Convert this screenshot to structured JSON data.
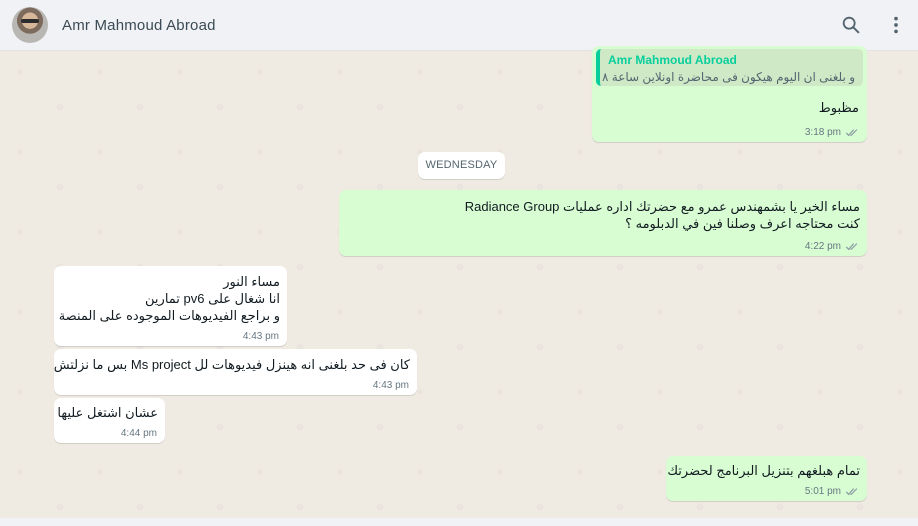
{
  "header": {
    "contact_name": "Amr Mahmoud Abroad",
    "search_icon": "search-icon",
    "menu_icon": "more-vertical-icon"
  },
  "colors": {
    "outgoing_bubble": "#d9fdd3",
    "incoming_bubble": "#ffffff",
    "chat_background": "#efeae2",
    "header_background": "#f0f2f5",
    "quote_accent": "#06cf9c",
    "tick_color": "#8696a0"
  },
  "date_separator": "WEDNESDAY",
  "messages": [
    {
      "direction": "out",
      "quote": {
        "author": "Amr Mahmoud Abroad",
        "text": "و بلغنى ان اليوم هيكون فى محاضرة اونلاين ساعة ٨"
      },
      "lines": [
        "مظبوط"
      ],
      "time": "3:18 pm",
      "status": "read"
    },
    {
      "direction": "out",
      "lines": [
        "مساء الخير يا بشمهندس عمرو مع حضرتك اداره عمليات Radiance Group",
        "كنت محتاجه اعرف وصلنا فين في الدبلومه ؟"
      ],
      "time": "4:22 pm",
      "status": "read"
    },
    {
      "direction": "in",
      "lines": [
        "مساء النور",
        "انا شغال على pv6 تمارين",
        "و براجع الفيديوهات الموجوده على المنصة"
      ],
      "time": "4:43 pm"
    },
    {
      "direction": "in",
      "lines": [
        "كان فى حد بلغنى انه هينزل فيديوهات لل Ms project بس ما نزلتش"
      ],
      "time": "4:43 pm"
    },
    {
      "direction": "in",
      "lines": [
        "عشان اشتغل عليها"
      ],
      "time": "4:44 pm"
    },
    {
      "direction": "out",
      "lines": [
        "تمام هبلغهم بتنزيل البرنامج لحضرتك"
      ],
      "time": "5:01 pm",
      "status": "read"
    }
  ]
}
